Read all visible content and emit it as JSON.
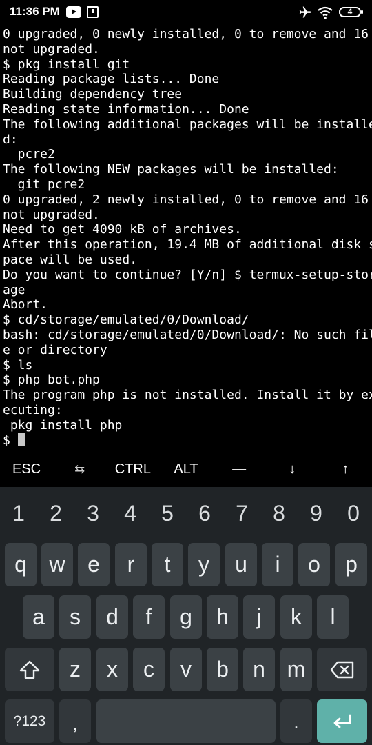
{
  "status_bar": {
    "time": "11:36 PM",
    "battery": "4",
    "icons": [
      "youtube-icon",
      "notification-icon",
      "airplane-icon",
      "wifi-icon",
      "battery-icon"
    ]
  },
  "terminal": {
    "lines": [
      "0 upgraded, 0 newly installed, 0 to remove and 16",
      "not upgraded.",
      "$ pkg install git",
      "Reading package lists... Done",
      "Building dependency tree",
      "Reading state information... Done",
      "The following additional packages will be installe",
      "d:",
      "  pcre2",
      "The following NEW packages will be installed:",
      "  git pcre2",
      "0 upgraded, 2 newly installed, 0 to remove and 16",
      "not upgraded.",
      "Need to get 4090 kB of archives.",
      "After this operation, 19.4 MB of additional disk s",
      "pace will be used.",
      "Do you want to continue? [Y/n] $ termux-setup-stor",
      "age",
      "Abort.",
      "$ cd/storage/emulated/0/Download/",
      "bash: cd/storage/emulated/0/Download/: No such fil",
      "e or directory",
      "$ ls",
      "$ php bot.php",
      "The program php is not installed. Install it by ex",
      "ecuting:",
      " pkg install php"
    ],
    "prompt": "$ "
  },
  "extra_keys": [
    "ESC",
    "⇆",
    "CTRL",
    "ALT",
    "—",
    "↓",
    "↑"
  ],
  "keyboard": {
    "numbers": [
      "1",
      "2",
      "3",
      "4",
      "5",
      "6",
      "7",
      "8",
      "9",
      "0"
    ],
    "row1": [
      "q",
      "w",
      "e",
      "r",
      "t",
      "y",
      "u",
      "i",
      "o",
      "p"
    ],
    "row2": [
      "a",
      "s",
      "d",
      "f",
      "g",
      "h",
      "j",
      "k",
      "l"
    ],
    "row3": [
      "z",
      "x",
      "c",
      "v",
      "b",
      "n",
      "m"
    ],
    "symbols_label": "?123",
    "comma": ",",
    "period": ".",
    "colors": {
      "background": "#202427",
      "key": "#3b4145",
      "enter": "#5fb1a9"
    }
  }
}
